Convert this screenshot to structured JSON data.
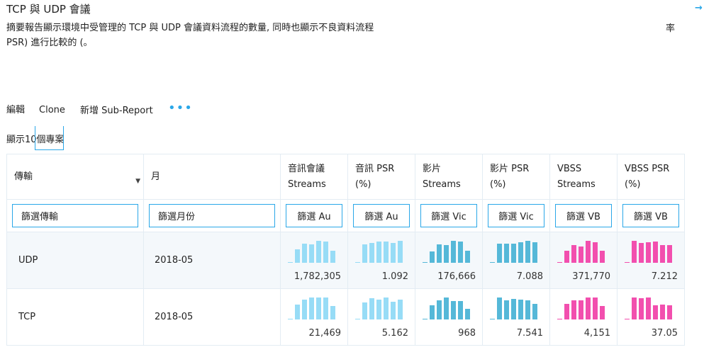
{
  "header": {
    "title": "TCP 與 UDP 會議",
    "description_line1": "摘要報告顯示環境中受管理的 TCP 與 UDP 會議資料流程的數量, 同時也顯示不良資料流程",
    "description_line2": "PSR) 進行比較的 (。",
    "stray_char": "率",
    "arrow_icon": "→"
  },
  "toolbar": {
    "edit": "編輯",
    "clone": "Clone",
    "add_subreport": "新增 Sub-Report",
    "more": "•••"
  },
  "show_items": "顯示10個專案",
  "colors": {
    "light_blue": "#97dcf6",
    "mid_blue": "#55b8d8",
    "pink": "#f24fae",
    "accent": "#2aa7e8"
  },
  "table": {
    "columns": [
      {
        "l1": "傳輸",
        "l2": "",
        "filter": "篩選傳輸",
        "dropdown": true
      },
      {
        "l1": "月",
        "l2": "",
        "filter": "篩選月份"
      },
      {
        "l1": "音訊會議",
        "l2": "Streams",
        "filter": "篩選 Au"
      },
      {
        "l1": "音訊 PSR",
        "l2": "(%)",
        "filter": "篩選 Au"
      },
      {
        "l1": "影片",
        "l2": "Streams",
        "filter": "篩選 Vic"
      },
      {
        "l1": "影片 PSR",
        "l2": "(%)",
        "filter": "篩選 Vic"
      },
      {
        "l1": "VBSS",
        "l2": "Streams",
        "filter": "篩選 VB"
      },
      {
        "l1": "VBSS PSR",
        "l2": "(%)",
        "filter": "篩選 VB"
      }
    ],
    "rows": [
      {
        "transport": "UDP",
        "month": "2018-05",
        "metrics": [
          {
            "value": "1,782,305",
            "color": "light_blue",
            "spark": [
              0.03,
              0.6,
              0.87,
              0.83,
              1.0,
              0.97,
              0.55
            ]
          },
          {
            "value": "1.092",
            "color": "light_blue",
            "spark": [
              0.03,
              0.83,
              0.9,
              0.97,
              0.97,
              0.9,
              1.0
            ]
          },
          {
            "value": "176,666",
            "color": "mid_blue",
            "spark": [
              0.03,
              0.52,
              0.84,
              0.81,
              1.0,
              0.97,
              0.55
            ]
          },
          {
            "value": "7.088",
            "color": "mid_blue",
            "spark": [
              0.03,
              0.87,
              0.87,
              0.87,
              0.94,
              1.0,
              0.94
            ]
          },
          {
            "value": "371,770",
            "color": "pink",
            "spark": [
              0.03,
              0.55,
              0.81,
              0.74,
              1.0,
              0.94,
              0.55
            ]
          },
          {
            "value": "7.212",
            "color": "pink",
            "spark": [
              0.03,
              1.0,
              0.9,
              0.94,
              0.97,
              0.81,
              0.81
            ]
          }
        ]
      },
      {
        "transport": "TCP",
        "month": "2018-05",
        "metrics": [
          {
            "value": "21,469",
            "color": "light_blue",
            "spark": [
              0.03,
              0.68,
              0.9,
              1.0,
              1.0,
              1.0,
              0.61
            ]
          },
          {
            "value": "5.162",
            "color": "light_blue",
            "spark": [
              0.03,
              0.77,
              0.97,
              0.9,
              1.0,
              0.81,
              0.9
            ]
          },
          {
            "value": "968",
            "color": "mid_blue",
            "spark": [
              0.03,
              0.65,
              0.87,
              1.0,
              0.84,
              0.84,
              0.48
            ]
          },
          {
            "value": "7.541",
            "color": "mid_blue",
            "spark": [
              0.03,
              1.0,
              0.87,
              0.94,
              0.9,
              0.87,
              0.71
            ]
          },
          {
            "value": "4,151",
            "color": "pink",
            "spark": [
              0.03,
              0.71,
              0.87,
              0.87,
              1.0,
              1.0,
              0.61
            ]
          },
          {
            "value": "37.05",
            "color": "pink",
            "spark": [
              0.03,
              1.0,
              0.97,
              1.0,
              0.65,
              0.68,
              0.65
            ]
          }
        ]
      }
    ]
  }
}
